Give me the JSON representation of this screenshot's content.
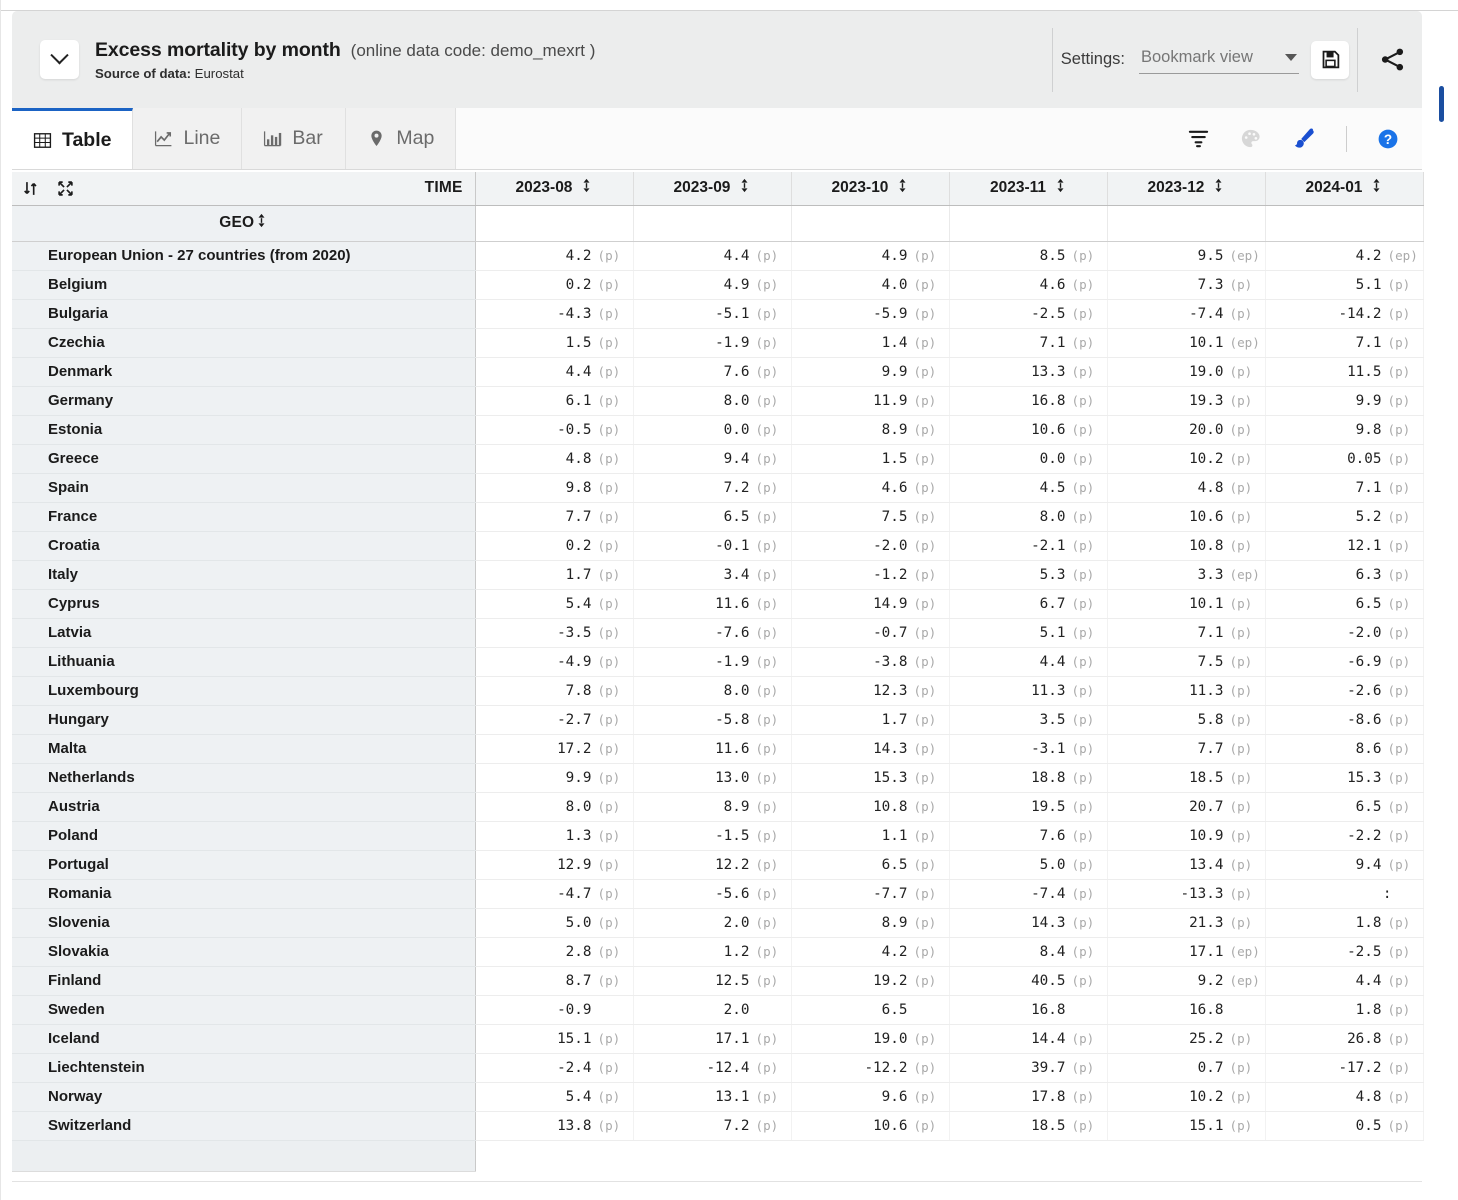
{
  "header": {
    "collapse_icon": "chevron-down-icon",
    "title": "Excess mortality by month",
    "data_code": "(online data code: demo_mexrt )",
    "source_label": "Source of data:",
    "source_value": "Eurostat",
    "settings_label": "Settings:",
    "bookmark_value": "Bookmark view",
    "save_icon": "floppy-disk-icon",
    "share_icon": "share-icon"
  },
  "tabs": [
    {
      "label": "Table",
      "icon": "table-grid-icon",
      "active": true
    },
    {
      "label": "Line",
      "icon": "line-chart-icon",
      "active": false
    },
    {
      "label": "Bar",
      "icon": "bar-chart-icon",
      "active": false
    },
    {
      "label": "Map",
      "icon": "map-pin-icon",
      "active": false
    }
  ],
  "toolbar": [
    {
      "name": "filter-icon",
      "state": "enabled"
    },
    {
      "name": "palette-icon",
      "state": "disabled"
    },
    {
      "name": "brush-icon",
      "state": "active"
    },
    {
      "name": "help-icon",
      "state": "enabled"
    }
  ],
  "table": {
    "sort_icon": "sort-updown-icon",
    "expand_icon": "expand-arrows-icon",
    "time_label": "TIME",
    "geo_label": "GEO",
    "columns": [
      "2023-08",
      "2023-09",
      "2023-10",
      "2023-11",
      "2023-12",
      "2024-01"
    ],
    "rows": [
      {
        "geo": "European Union - 27 countries (from 2020)",
        "cells": [
          {
            "v": "4.2",
            "f": "(p)"
          },
          {
            "v": "4.4",
            "f": "(p)"
          },
          {
            "v": "4.9",
            "f": "(p)"
          },
          {
            "v": "8.5",
            "f": "(p)"
          },
          {
            "v": "9.5",
            "f": "(ep)"
          },
          {
            "v": "4.2",
            "f": "(ep)"
          }
        ]
      },
      {
        "geo": "Belgium",
        "cells": [
          {
            "v": "0.2",
            "f": "(p)"
          },
          {
            "v": "4.9",
            "f": "(p)"
          },
          {
            "v": "4.0",
            "f": "(p)"
          },
          {
            "v": "4.6",
            "f": "(p)"
          },
          {
            "v": "7.3",
            "f": "(p)"
          },
          {
            "v": "5.1",
            "f": "(p)"
          }
        ]
      },
      {
        "geo": "Bulgaria",
        "cells": [
          {
            "v": "-4.3",
            "f": "(p)"
          },
          {
            "v": "-5.1",
            "f": "(p)"
          },
          {
            "v": "-5.9",
            "f": "(p)"
          },
          {
            "v": "-2.5",
            "f": "(p)"
          },
          {
            "v": "-7.4",
            "f": "(p)"
          },
          {
            "v": "-14.2",
            "f": "(p)"
          }
        ]
      },
      {
        "geo": "Czechia",
        "cells": [
          {
            "v": "1.5",
            "f": "(p)"
          },
          {
            "v": "-1.9",
            "f": "(p)"
          },
          {
            "v": "1.4",
            "f": "(p)"
          },
          {
            "v": "7.1",
            "f": "(p)"
          },
          {
            "v": "10.1",
            "f": "(ep)"
          },
          {
            "v": "7.1",
            "f": "(p)"
          }
        ]
      },
      {
        "geo": "Denmark",
        "cells": [
          {
            "v": "4.4",
            "f": "(p)"
          },
          {
            "v": "7.6",
            "f": "(p)"
          },
          {
            "v": "9.9",
            "f": "(p)"
          },
          {
            "v": "13.3",
            "f": "(p)"
          },
          {
            "v": "19.0",
            "f": "(p)"
          },
          {
            "v": "11.5",
            "f": "(p)"
          }
        ]
      },
      {
        "geo": "Germany",
        "cells": [
          {
            "v": "6.1",
            "f": "(p)"
          },
          {
            "v": "8.0",
            "f": "(p)"
          },
          {
            "v": "11.9",
            "f": "(p)"
          },
          {
            "v": "16.8",
            "f": "(p)"
          },
          {
            "v": "19.3",
            "f": "(p)"
          },
          {
            "v": "9.9",
            "f": "(p)"
          }
        ]
      },
      {
        "geo": "Estonia",
        "cells": [
          {
            "v": "-0.5",
            "f": "(p)"
          },
          {
            "v": "0.0",
            "f": "(p)"
          },
          {
            "v": "8.9",
            "f": "(p)"
          },
          {
            "v": "10.6",
            "f": "(p)"
          },
          {
            "v": "20.0",
            "f": "(p)"
          },
          {
            "v": "9.8",
            "f": "(p)"
          }
        ]
      },
      {
        "geo": "Greece",
        "cells": [
          {
            "v": "4.8",
            "f": "(p)"
          },
          {
            "v": "9.4",
            "f": "(p)"
          },
          {
            "v": "1.5",
            "f": "(p)"
          },
          {
            "v": "0.0",
            "f": "(p)"
          },
          {
            "v": "10.2",
            "f": "(p)"
          },
          {
            "v": "0.05",
            "f": "(p)"
          }
        ]
      },
      {
        "geo": "Spain",
        "cells": [
          {
            "v": "9.8",
            "f": "(p)"
          },
          {
            "v": "7.2",
            "f": "(p)"
          },
          {
            "v": "4.6",
            "f": "(p)"
          },
          {
            "v": "4.5",
            "f": "(p)"
          },
          {
            "v": "4.8",
            "f": "(p)"
          },
          {
            "v": "7.1",
            "f": "(p)"
          }
        ]
      },
      {
        "geo": "France",
        "cells": [
          {
            "v": "7.7",
            "f": "(p)"
          },
          {
            "v": "6.5",
            "f": "(p)"
          },
          {
            "v": "7.5",
            "f": "(p)"
          },
          {
            "v": "8.0",
            "f": "(p)"
          },
          {
            "v": "10.6",
            "f": "(p)"
          },
          {
            "v": "5.2",
            "f": "(p)"
          }
        ]
      },
      {
        "geo": "Croatia",
        "cells": [
          {
            "v": "0.2",
            "f": "(p)"
          },
          {
            "v": "-0.1",
            "f": "(p)"
          },
          {
            "v": "-2.0",
            "f": "(p)"
          },
          {
            "v": "-2.1",
            "f": "(p)"
          },
          {
            "v": "10.8",
            "f": "(p)"
          },
          {
            "v": "12.1",
            "f": "(p)"
          }
        ]
      },
      {
        "geo": "Italy",
        "cells": [
          {
            "v": "1.7",
            "f": "(p)"
          },
          {
            "v": "3.4",
            "f": "(p)"
          },
          {
            "v": "-1.2",
            "f": "(p)"
          },
          {
            "v": "5.3",
            "f": "(p)"
          },
          {
            "v": "3.3",
            "f": "(ep)"
          },
          {
            "v": "6.3",
            "f": "(p)"
          }
        ]
      },
      {
        "geo": "Cyprus",
        "cells": [
          {
            "v": "5.4",
            "f": "(p)"
          },
          {
            "v": "11.6",
            "f": "(p)"
          },
          {
            "v": "14.9",
            "f": "(p)"
          },
          {
            "v": "6.7",
            "f": "(p)"
          },
          {
            "v": "10.1",
            "f": "(p)"
          },
          {
            "v": "6.5",
            "f": "(p)"
          }
        ]
      },
      {
        "geo": "Latvia",
        "cells": [
          {
            "v": "-3.5",
            "f": "(p)"
          },
          {
            "v": "-7.6",
            "f": "(p)"
          },
          {
            "v": "-0.7",
            "f": "(p)"
          },
          {
            "v": "5.1",
            "f": "(p)"
          },
          {
            "v": "7.1",
            "f": "(p)"
          },
          {
            "v": "-2.0",
            "f": "(p)"
          }
        ]
      },
      {
        "geo": "Lithuania",
        "cells": [
          {
            "v": "-4.9",
            "f": "(p)"
          },
          {
            "v": "-1.9",
            "f": "(p)"
          },
          {
            "v": "-3.8",
            "f": "(p)"
          },
          {
            "v": "4.4",
            "f": "(p)"
          },
          {
            "v": "7.5",
            "f": "(p)"
          },
          {
            "v": "-6.9",
            "f": "(p)"
          }
        ]
      },
      {
        "geo": "Luxembourg",
        "cells": [
          {
            "v": "7.8",
            "f": "(p)"
          },
          {
            "v": "8.0",
            "f": "(p)"
          },
          {
            "v": "12.3",
            "f": "(p)"
          },
          {
            "v": "11.3",
            "f": "(p)"
          },
          {
            "v": "11.3",
            "f": "(p)"
          },
          {
            "v": "-2.6",
            "f": "(p)"
          }
        ]
      },
      {
        "geo": "Hungary",
        "cells": [
          {
            "v": "-2.7",
            "f": "(p)"
          },
          {
            "v": "-5.8",
            "f": "(p)"
          },
          {
            "v": "1.7",
            "f": "(p)"
          },
          {
            "v": "3.5",
            "f": "(p)"
          },
          {
            "v": "5.8",
            "f": "(p)"
          },
          {
            "v": "-8.6",
            "f": "(p)"
          }
        ]
      },
      {
        "geo": "Malta",
        "cells": [
          {
            "v": "17.2",
            "f": "(p)"
          },
          {
            "v": "11.6",
            "f": "(p)"
          },
          {
            "v": "14.3",
            "f": "(p)"
          },
          {
            "v": "-3.1",
            "f": "(p)"
          },
          {
            "v": "7.7",
            "f": "(p)"
          },
          {
            "v": "8.6",
            "f": "(p)"
          }
        ]
      },
      {
        "geo": "Netherlands",
        "cells": [
          {
            "v": "9.9",
            "f": "(p)"
          },
          {
            "v": "13.0",
            "f": "(p)"
          },
          {
            "v": "15.3",
            "f": "(p)"
          },
          {
            "v": "18.8",
            "f": "(p)"
          },
          {
            "v": "18.5",
            "f": "(p)"
          },
          {
            "v": "15.3",
            "f": "(p)"
          }
        ]
      },
      {
        "geo": "Austria",
        "cells": [
          {
            "v": "8.0",
            "f": "(p)"
          },
          {
            "v": "8.9",
            "f": "(p)"
          },
          {
            "v": "10.8",
            "f": "(p)"
          },
          {
            "v": "19.5",
            "f": "(p)"
          },
          {
            "v": "20.7",
            "f": "(p)"
          },
          {
            "v": "6.5",
            "f": "(p)"
          }
        ]
      },
      {
        "geo": "Poland",
        "cells": [
          {
            "v": "1.3",
            "f": "(p)"
          },
          {
            "v": "-1.5",
            "f": "(p)"
          },
          {
            "v": "1.1",
            "f": "(p)"
          },
          {
            "v": "7.6",
            "f": "(p)"
          },
          {
            "v": "10.9",
            "f": "(p)"
          },
          {
            "v": "-2.2",
            "f": "(p)"
          }
        ]
      },
      {
        "geo": "Portugal",
        "cells": [
          {
            "v": "12.9",
            "f": "(p)"
          },
          {
            "v": "12.2",
            "f": "(p)"
          },
          {
            "v": "6.5",
            "f": "(p)"
          },
          {
            "v": "5.0",
            "f": "(p)"
          },
          {
            "v": "13.4",
            "f": "(p)"
          },
          {
            "v": "9.4",
            "f": "(p)"
          }
        ]
      },
      {
        "geo": "Romania",
        "cells": [
          {
            "v": "-4.7",
            "f": "(p)"
          },
          {
            "v": "-5.6",
            "f": "(p)"
          },
          {
            "v": "-7.7",
            "f": "(p)"
          },
          {
            "v": "-7.4",
            "f": "(p)"
          },
          {
            "v": "-13.3",
            "f": "(p)"
          },
          {
            "v": ":",
            "f": "",
            "missing": true
          }
        ]
      },
      {
        "geo": "Slovenia",
        "cells": [
          {
            "v": "5.0",
            "f": "(p)"
          },
          {
            "v": "2.0",
            "f": "(p)"
          },
          {
            "v": "8.9",
            "f": "(p)"
          },
          {
            "v": "14.3",
            "f": "(p)"
          },
          {
            "v": "21.3",
            "f": "(p)"
          },
          {
            "v": "1.8",
            "f": "(p)"
          }
        ]
      },
      {
        "geo": "Slovakia",
        "cells": [
          {
            "v": "2.8",
            "f": "(p)"
          },
          {
            "v": "1.2",
            "f": "(p)"
          },
          {
            "v": "4.2",
            "f": "(p)"
          },
          {
            "v": "8.4",
            "f": "(p)"
          },
          {
            "v": "17.1",
            "f": "(ep)"
          },
          {
            "v": "-2.5",
            "f": "(p)"
          }
        ]
      },
      {
        "geo": "Finland",
        "cells": [
          {
            "v": "8.7",
            "f": "(p)"
          },
          {
            "v": "12.5",
            "f": "(p)"
          },
          {
            "v": "19.2",
            "f": "(p)"
          },
          {
            "v": "40.5",
            "f": "(p)"
          },
          {
            "v": "9.2",
            "f": "(ep)"
          },
          {
            "v": "4.4",
            "f": "(p)"
          }
        ]
      },
      {
        "geo": "Sweden",
        "cells": [
          {
            "v": "-0.9",
            "f": ""
          },
          {
            "v": "2.0",
            "f": ""
          },
          {
            "v": "6.5",
            "f": ""
          },
          {
            "v": "16.8",
            "f": ""
          },
          {
            "v": "16.8",
            "f": ""
          },
          {
            "v": "1.8",
            "f": "(p)"
          }
        ]
      },
      {
        "geo": "Iceland",
        "cells": [
          {
            "v": "15.1",
            "f": "(p)"
          },
          {
            "v": "17.1",
            "f": "(p)"
          },
          {
            "v": "19.0",
            "f": "(p)"
          },
          {
            "v": "14.4",
            "f": "(p)"
          },
          {
            "v": "25.2",
            "f": "(p)"
          },
          {
            "v": "26.8",
            "f": "(p)"
          }
        ]
      },
      {
        "geo": "Liechtenstein",
        "cells": [
          {
            "v": "-2.4",
            "f": "(p)"
          },
          {
            "v": "-12.4",
            "f": "(p)"
          },
          {
            "v": "-12.2",
            "f": "(p)"
          },
          {
            "v": "39.7",
            "f": "(p)"
          },
          {
            "v": "0.7",
            "f": "(p)"
          },
          {
            "v": "-17.2",
            "f": "(p)"
          }
        ]
      },
      {
        "geo": "Norway",
        "cells": [
          {
            "v": "5.4",
            "f": "(p)"
          },
          {
            "v": "13.1",
            "f": "(p)"
          },
          {
            "v": "9.6",
            "f": "(p)"
          },
          {
            "v": "17.8",
            "f": "(p)"
          },
          {
            "v": "10.2",
            "f": "(p)"
          },
          {
            "v": "4.8",
            "f": "(p)"
          }
        ]
      },
      {
        "geo": "Switzerland",
        "cells": [
          {
            "v": "13.8",
            "f": "(p)"
          },
          {
            "v": "7.2",
            "f": "(p)"
          },
          {
            "v": "10.6",
            "f": "(p)"
          },
          {
            "v": "18.5",
            "f": "(p)"
          },
          {
            "v": "15.1",
            "f": "(p)"
          },
          {
            "v": "0.5",
            "f": "(p)"
          }
        ]
      }
    ]
  },
  "colors": {
    "accent_blue": "#1b63c4",
    "help_blue": "#1a73e8",
    "header_bg": "#eceded",
    "geo_col_bg": "#eef1f3",
    "col_header_bg": "#f1f3f4"
  }
}
